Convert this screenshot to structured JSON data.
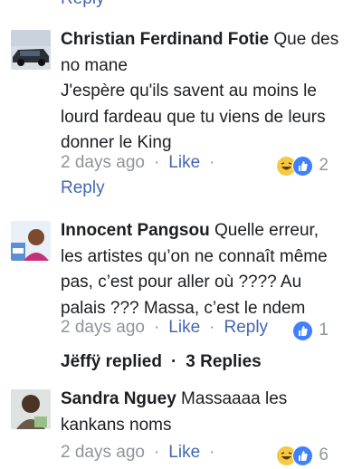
{
  "top_reply_label": "Reply",
  "comments": [
    {
      "author": "Christian Ferdinand Fotie",
      "text_lines": [
        "Que des",
        "no mane",
        "J'espère qu'ils savent au moins le",
        "lourd fardeau que tu viens de leurs",
        "donner le King"
      ],
      "time": "2 days ago",
      "like_label": "Like",
      "reaction_count": "2",
      "reply_label": "Reply",
      "reactions": [
        "haha-icon",
        "like-icon"
      ]
    },
    {
      "author": "Innocent Pangsou",
      "text_lines": [
        "Quelle erreur,",
        "les artistes qu’on ne connaît même",
        "pas, c’est pour aller où ????  Au",
        "palais ???  Massa, c’est le ndem"
      ],
      "time": "2 days ago",
      "like_label": "Like",
      "reply_label": "Reply",
      "reaction_count": "1",
      "reactions": [
        "like-icon"
      ],
      "replies": {
        "who": "Jëffÿ replied",
        "count": "3 Replies"
      }
    },
    {
      "author": "Sandra Nguey",
      "text_lines": [
        "Massaaaa les",
        "kankans noms"
      ],
      "time": "2 days ago",
      "like_label": "Like",
      "reaction_count": "6",
      "reactions": [
        "haha-icon",
        "like-icon"
      ]
    }
  ],
  "colors": {
    "link": "#4267b2",
    "meta": "#90949c",
    "like": "#4080ff",
    "haha": "#f7c843"
  }
}
